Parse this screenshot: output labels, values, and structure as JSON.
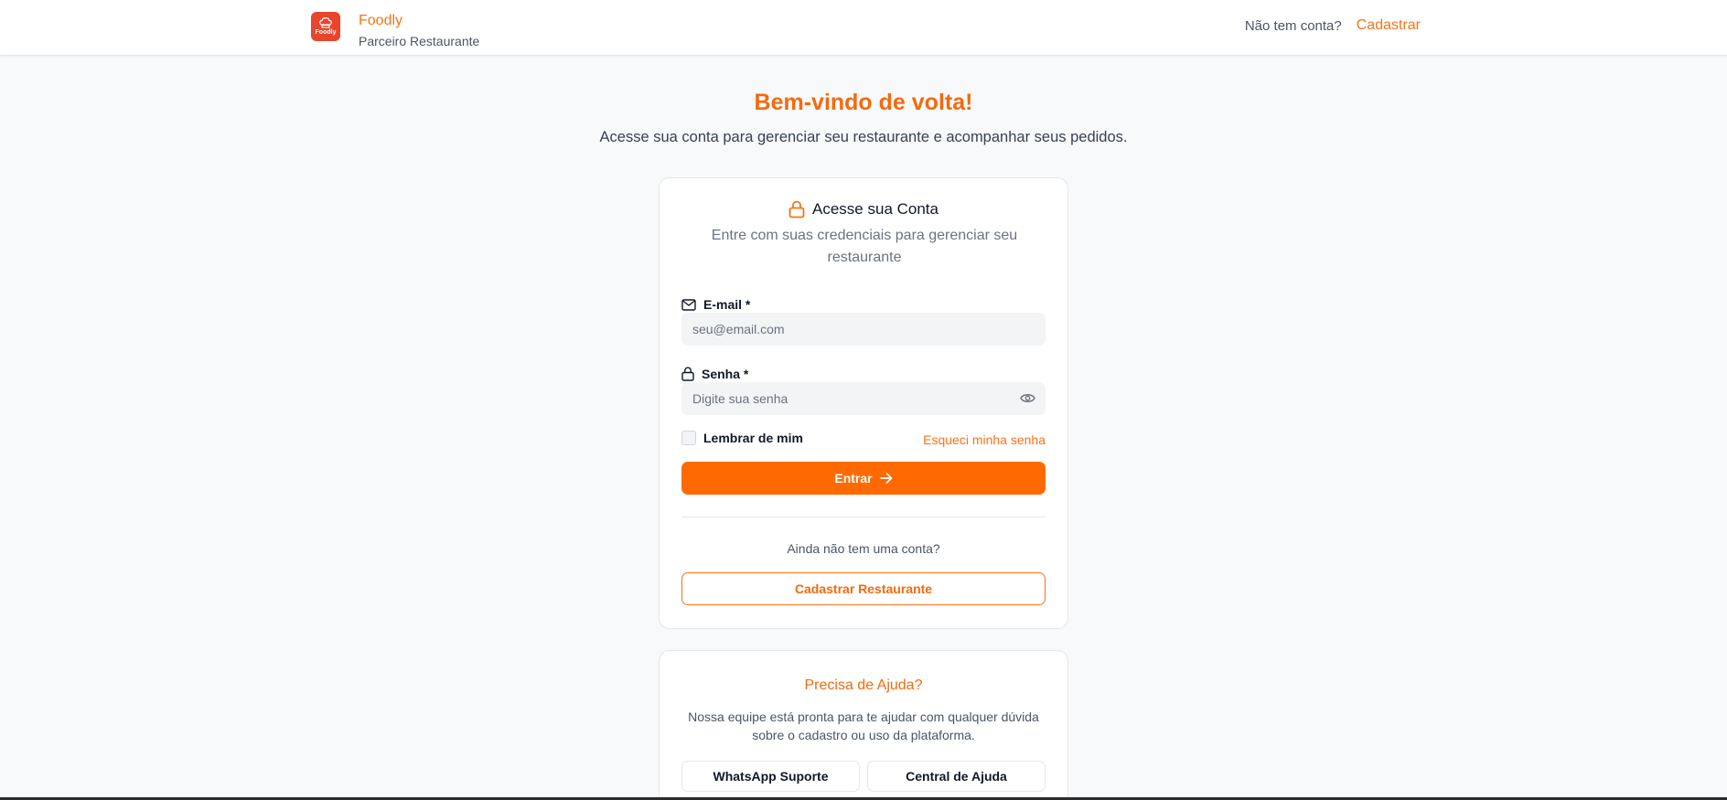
{
  "header": {
    "brand_name": "Foodly",
    "brand_subtitle": "Parceiro Restaurante",
    "logo_text": "Foodly",
    "no_account_text": "Não tem conta?",
    "signup_link": "Cadastrar"
  },
  "welcome": {
    "title": "Bem-vindo de volta!",
    "subtitle": "Acesse sua conta para gerenciar seu restaurante e acompanhar seus pedidos."
  },
  "login_card": {
    "title": "Acesse sua Conta",
    "description": "Entre com suas credenciais para gerenciar seu restaurante",
    "email_label": "E-mail *",
    "email_placeholder": "seu@email.com",
    "email_value": "",
    "password_label": "Senha *",
    "password_placeholder": "Digite sua senha",
    "password_value": "",
    "remember_label": "Lembrar de mim",
    "remember_checked": false,
    "forgot_link": "Esqueci minha senha",
    "submit_label": "Entrar",
    "no_account_question": "Ainda não tem uma conta?",
    "register_button": "Cadastrar Restaurante"
  },
  "help_card": {
    "title": "Precisa de Ajuda?",
    "description": "Nossa equipe está pronta para te ajudar com qualquer dúvida sobre o cadastro ou uso da plataforma.",
    "whatsapp_button": "WhatsApp Suporte",
    "help_center_button": "Central de Ajuda"
  },
  "icons": {
    "logo": "chef-hat-icon",
    "card_title": "lock-icon",
    "email": "mail-icon",
    "password": "lock-icon",
    "show_password": "eye-icon",
    "submit": "arrow-right-icon"
  },
  "colors": {
    "accent": "#f97316",
    "primary_button": "#ff6a00",
    "logo_bg": "#e8452c",
    "page_bg": "#f8f9fb"
  }
}
